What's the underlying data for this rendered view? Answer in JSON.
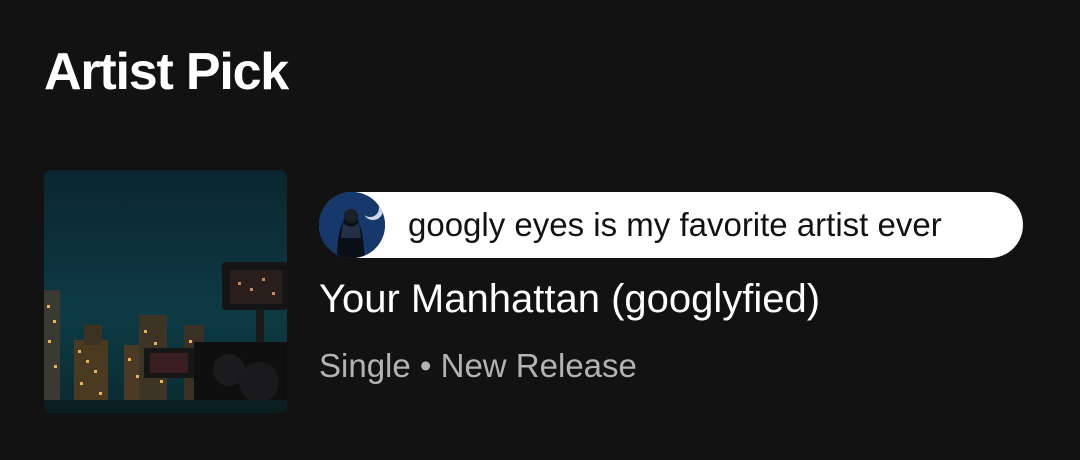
{
  "section": {
    "title": "Artist Pick"
  },
  "pick": {
    "comment": "googly eyes is my favorite artist ever",
    "title": "Your Manhattan (googlyfied)",
    "meta": "Single • New Release",
    "avatar_icon": "artist-avatar",
    "artwork_icon": "album-artwork"
  },
  "colors": {
    "background": "#121212",
    "primary_text": "#FFFFFF",
    "secondary_text": "#B3B3B3",
    "pill_background": "#FFFFFF",
    "pill_text": "#121212"
  }
}
